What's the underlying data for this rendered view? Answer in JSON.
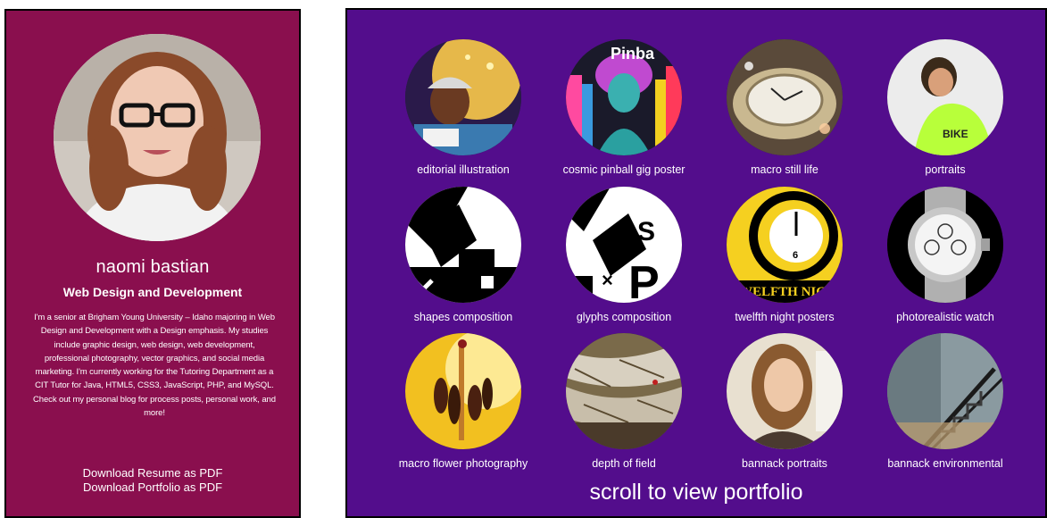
{
  "profile": {
    "name": "naomi bastian",
    "subtitle": "Web Design and Development",
    "bio": "I'm a senior at Brigham Young University – Idaho majoring in Web Design and Development with a Design emphasis. My studies include graphic design, web design, web development, professional photography, vector graphics, and social media marketing. I'm currently working for the Tutoring Department as a CIT Tutor for Java, HTML5, CSS3, JavaScript, PHP, and MySQL. Check out my personal blog for process posts, personal work, and more!",
    "download_resume": "Download Resume as PDF",
    "download_portfolio": "Download Portfolio as PDF"
  },
  "portfolio": {
    "items": [
      {
        "label": "editorial illustration",
        "icon": "illustration-thumbnail"
      },
      {
        "label": "cosmic pinball gig poster",
        "icon": "poster-thumbnail",
        "thumb_text": "Pinba"
      },
      {
        "label": "macro still life",
        "icon": "watch-macro-thumbnail"
      },
      {
        "label": "portraits",
        "icon": "portrait-thumbnail"
      },
      {
        "label": "shapes composition",
        "icon": "shapes-thumbnail"
      },
      {
        "label": "glyphs composition",
        "icon": "glyphs-thumbnail"
      },
      {
        "label": "twelfth night posters",
        "icon": "clock-poster-thumbnail",
        "thumb_text": "TWELFTH NIGH"
      },
      {
        "label": "photorealistic watch",
        "icon": "watch-thumbnail"
      },
      {
        "label": "macro flower photography",
        "icon": "flower-thumbnail"
      },
      {
        "label": "depth of field",
        "icon": "bark-thumbnail"
      },
      {
        "label": "bannack portraits",
        "icon": "woman-portrait-thumbnail"
      },
      {
        "label": "bannack environmental",
        "icon": "stairs-thumbnail"
      }
    ],
    "scroll_hint": "scroll to view portfolio"
  },
  "colors": {
    "profile_bg": "#8a0f4e",
    "portfolio_bg": "#530d8c",
    "text": "#ffffff"
  }
}
